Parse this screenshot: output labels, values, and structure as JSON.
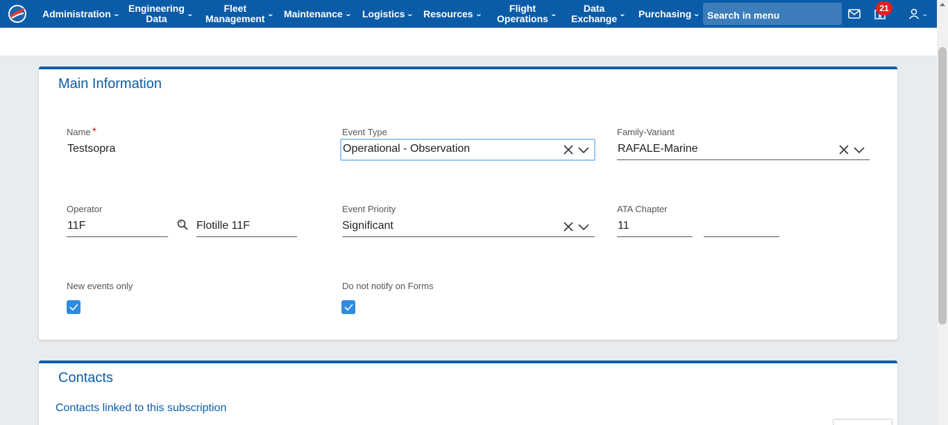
{
  "navbar": {
    "items": [
      {
        "label": "Administration"
      },
      {
        "label": "Engineering Data",
        "line1": "Engineering",
        "line2": "Data"
      },
      {
        "label": "Fleet Management",
        "line1": "Fleet",
        "line2": "Management"
      },
      {
        "label": "Maintenance"
      },
      {
        "label": "Logistics"
      },
      {
        "label": "Resources"
      },
      {
        "label": "Flight Operations",
        "line1": "Flight",
        "line2": "Operations"
      },
      {
        "label": "Data Exchange",
        "line1": "Data",
        "line2": "Exchange"
      },
      {
        "label": "Purchasing"
      }
    ],
    "search_value": "Search in menu",
    "notifications_count": "21",
    "icons": {
      "mail": "mail-icon",
      "dashboard": "dashboard-icon",
      "user": "user-icon"
    }
  },
  "main_information": {
    "title": "Main Information",
    "name": {
      "label": "Name",
      "required_mark": "*",
      "value": "Testsopra"
    },
    "event_type": {
      "label": "Event Type",
      "value": "Operational - Observation"
    },
    "family_variant": {
      "label": "Family-Variant",
      "value": "RAFALE-Marine"
    },
    "operator": {
      "label": "Operator",
      "code": "11F",
      "name": "Flotille 11F"
    },
    "event_priority": {
      "label": "Event Priority",
      "value": "Significant"
    },
    "ata_chapter": {
      "label": "ATA Chapter",
      "value": "11",
      "value2": ""
    },
    "new_events_only": {
      "label": "New events only",
      "checked": true
    },
    "do_not_notify": {
      "label": "Do not notify on Forms",
      "checked": true
    }
  },
  "contacts": {
    "title": "Contacts",
    "link": "Contacts linked to this subscription"
  },
  "colors": {
    "primary": "#0b5ca8",
    "checkbox": "#2f8be0",
    "badge": "#e02020"
  }
}
